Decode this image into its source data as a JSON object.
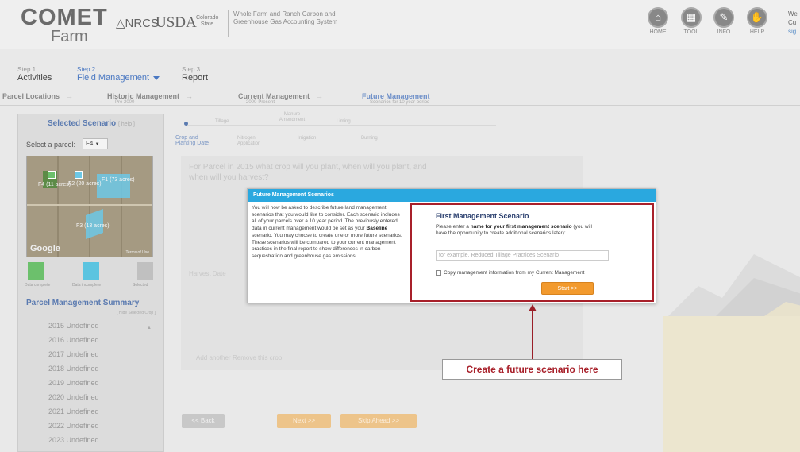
{
  "header": {
    "logo_main": "COMET",
    "logo_sub": "Farm",
    "partner1": "△NRCS",
    "partner2": "USDA",
    "partner3": "Colorado State",
    "subtitle": "Whole Farm and Ranch Carbon and Greenhouse Gas Accounting System",
    "nav": [
      {
        "label": "HOME",
        "icon": "home-icon"
      },
      {
        "label": "TOOL",
        "icon": "tool-icon"
      },
      {
        "label": "INFO",
        "icon": "info-icon"
      },
      {
        "label": "HELP",
        "icon": "help-icon"
      }
    ],
    "welcome": "We",
    "welcome2": "Cu",
    "welcome3": "sig"
  },
  "steps": [
    {
      "num": "Step 1",
      "name": "Activities"
    },
    {
      "num": "Step 2",
      "name": "Field Management"
    },
    {
      "num": "Step 3",
      "name": "Report"
    }
  ],
  "subnav": [
    {
      "name": "Parcel Locations",
      "sub": ""
    },
    {
      "name": "Historic Management",
      "sub": "Pre 2000"
    },
    {
      "name": "Current Management",
      "sub": "2000-Present"
    },
    {
      "name": "Future Management",
      "sub": "Scenarios for 10 year period"
    }
  ],
  "sidebar": {
    "selected_title": "Selected Scenario",
    "selected_hint": "[ help ]",
    "parcel_label": "Select a parcel:",
    "parcel_value": "F4",
    "map": {
      "labels": [
        "F4 (11 acres)",
        "F2 (20 acres)",
        "F1 (73 acres)",
        "F3 (13 acres)"
      ],
      "google": "Google",
      "terms": "Terms of Use"
    },
    "legend": [
      {
        "label": "Data complete",
        "color": "#6cc06c"
      },
      {
        "label": "Data incomplete",
        "color": "#5bc4e0"
      },
      {
        "label": "Selected",
        "color": "#c0c0c0"
      }
    ],
    "summary_title": "Parcel Management Summary",
    "summary_link": "[ Hide Selected Crop ]",
    "years": [
      "2015 Undefined",
      "2016 Undefined",
      "2017 Undefined",
      "2018 Undefined",
      "2019 Undefined",
      "2020 Undefined",
      "2021 Undefined",
      "2022 Undefined",
      "2023 Undefined"
    ]
  },
  "timeline": {
    "active": "Crop and Planting Date",
    "items": [
      "Tillage",
      "Manure Amendment",
      "Liming",
      "Nitrogen Application",
      "Irrigation",
      "Burning"
    ]
  },
  "main": {
    "question": "For Parcel in 2015 what crop will you plant, when will you plant, and when will you harvest?",
    "harvest_label": "Harvest Date",
    "add_another": "Add another",
    "remove_crop": "Remove this crop",
    "back_label": "<< Back",
    "next_label": "Next >>",
    "skip_label": "Skip Ahead >>"
  },
  "modal": {
    "title": "Future Management Scenarios",
    "left_text_1": "You will now be asked to describe future land management scenarios that you would like to consider. Each scenario includes all of your parcels over a 10 year period. The previously entered data in current management would be set as your ",
    "left_bold": "Baseline",
    "left_text_2": " scenario. You may choose to create one or more future scenarios. These scenarios will be compared to your current management practices in the final report to show differences in carbon sequestration and greenhouse gas emissions.",
    "right_title": "First Management Scenario",
    "right_text_1": "Please enter a ",
    "right_bold": "name for your first management scenario",
    "right_text_2": " (you will have the opportunity to create additional scenarios later):",
    "input_placeholder": "for example, Reduced Tillage Practices Scenario",
    "checkbox_label": "Copy management information from my Current Management",
    "start_label": "Start >>"
  },
  "callout": {
    "text": "Create a future scenario here",
    "color": "#a8202a"
  },
  "colors": {
    "accent_blue": "#2aa8df",
    "start_orange": "#f29a2e",
    "link_blue": "#4a78c2"
  }
}
